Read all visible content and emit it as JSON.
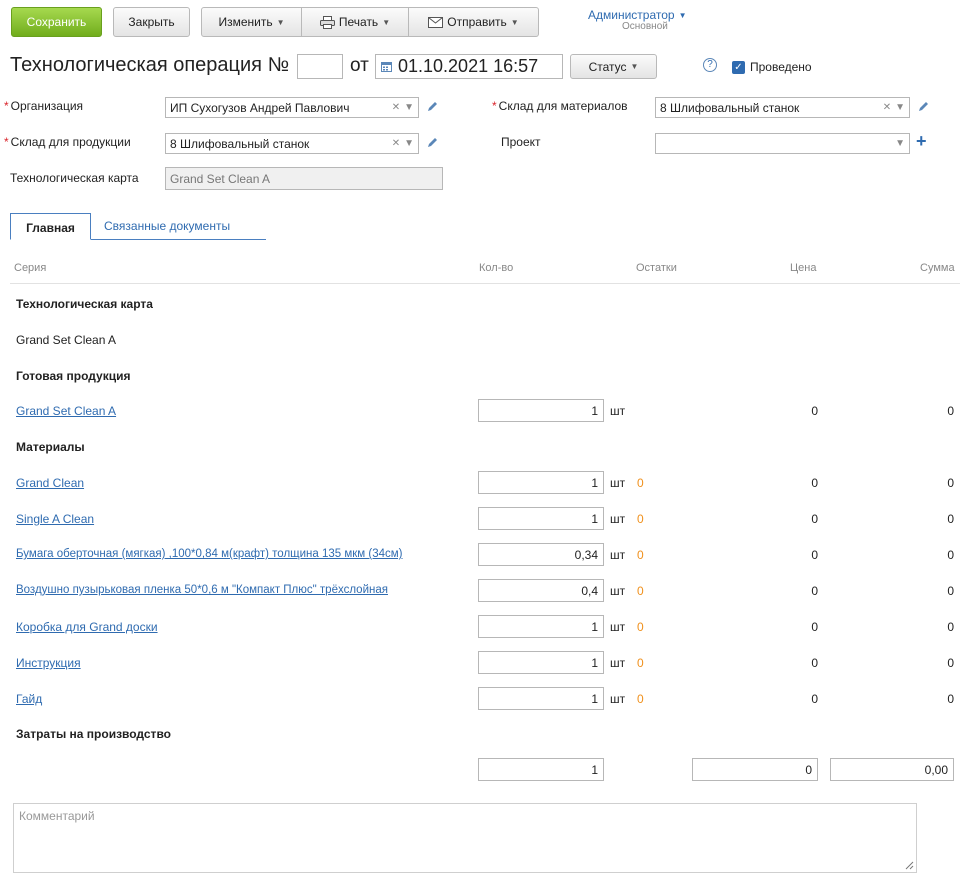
{
  "toolbar": {
    "save": "Сохранить",
    "close": "Закрыть",
    "edit": "Изменить",
    "print": "Печать",
    "send": "Отправить"
  },
  "user": {
    "name": "Администратор",
    "role": "Основной"
  },
  "doc": {
    "title": "Технологическая операция №",
    "number": "",
    "from": "от",
    "date": "01.10.2021 16:57",
    "status": "Статус",
    "posted": "Проведено"
  },
  "form": {
    "org_label": "Организация",
    "org_value": "ИП Сухогузов Андрей Павлович",
    "prod_wh_label": "Склад для продукции",
    "prod_wh_value": "8 Шлифовальный станок",
    "tech_card_label": "Технологическая карта",
    "tech_card_value": "Grand Set Clean A",
    "mat_wh_label": "Склад для материалов",
    "mat_wh_value": "8 Шлифовальный станок",
    "project_label": "Проект",
    "project_value": ""
  },
  "tabs": {
    "main": "Главная",
    "related": "Связанные документы"
  },
  "table": {
    "headers": {
      "series": "Серия",
      "qty": "Кол-во",
      "rem": "Остатки",
      "price": "Цена",
      "sum": "Сумма"
    },
    "tech_card_section": "Технологическая карта",
    "tech_card_name": "Grand Set Clean A",
    "products_section": "Готовая продукция",
    "product": {
      "name": "Grand Set Clean A",
      "qty": "1",
      "unit": "шт",
      "price": "0",
      "sum": "0"
    },
    "materials_section": "Материалы",
    "materials": [
      {
        "name": "Grand Clean",
        "qty": "1",
        "unit": "шт",
        "rem": "0",
        "price": "0",
        "sum": "0"
      },
      {
        "name": "Single A Clean",
        "qty": "1",
        "unit": "шт",
        "rem": "0",
        "price": "0",
        "sum": "0"
      },
      {
        "name": "Бумага оберточная (мягкая) ,100*0,84 м(крафт) толщина 135 мкм (34см)",
        "qty": "0,34",
        "unit": "шт",
        "rem": "0",
        "price": "0",
        "sum": "0"
      },
      {
        "name": "Воздушно пузырьковая пленка 50*0,6 м \"Компакт Плюс\" трёхслойная",
        "qty": "0,4",
        "unit": "шт",
        "rem": "0",
        "price": "0",
        "sum": "0"
      },
      {
        "name": "Коробка для Grand доски",
        "qty": "1",
        "unit": "шт",
        "rem": "0",
        "price": "0",
        "sum": "0"
      },
      {
        "name": "Инструкция",
        "qty": "1",
        "unit": "шт",
        "rem": "0",
        "price": "0",
        "sum": "0"
      },
      {
        "name": "Гайд",
        "qty": "1",
        "unit": "шт",
        "rem": "0",
        "price": "0",
        "sum": "0"
      }
    ],
    "costs_section": "Затраты на производство",
    "costs": {
      "qty": "1",
      "price": "0",
      "sum": "0,00"
    }
  },
  "comment": {
    "placeholder": "Комментарий"
  }
}
